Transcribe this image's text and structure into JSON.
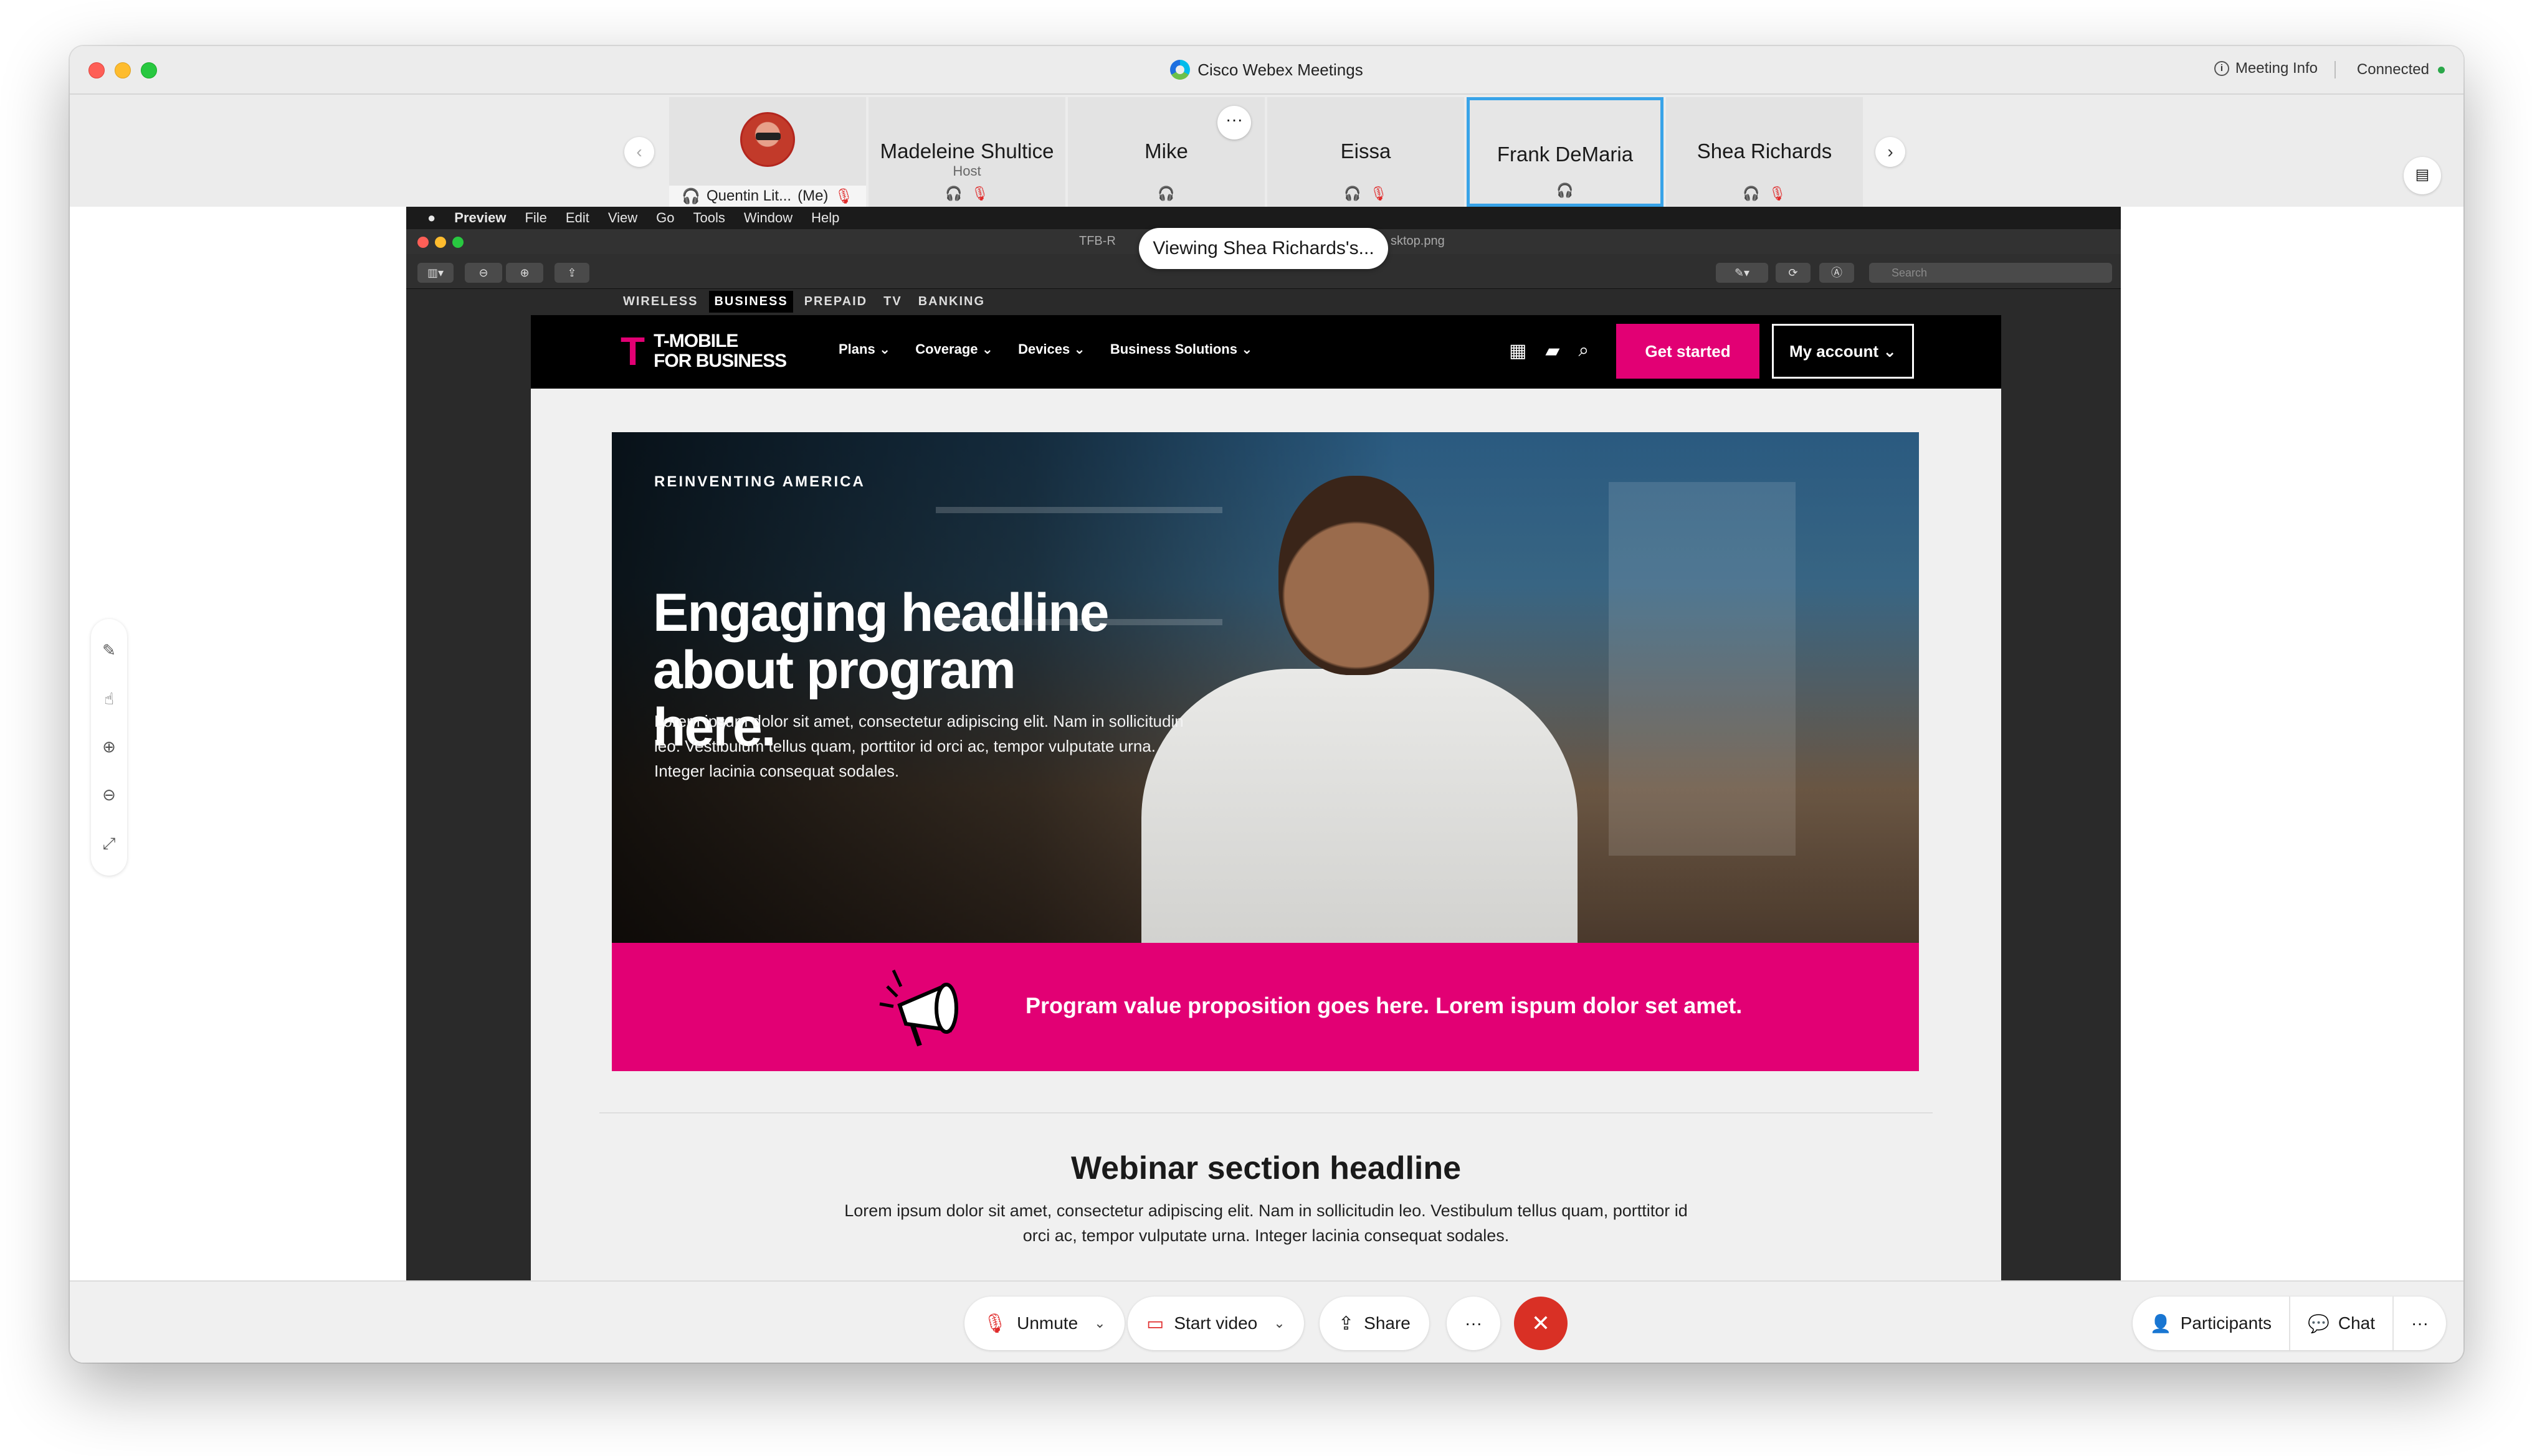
{
  "window": {
    "title": "Cisco Webex Meetings",
    "meeting_info_label": "Meeting Info",
    "connection_status": "Connected",
    "status_color": "#2ba84a"
  },
  "participants": [
    {
      "name": "Quentin Lit...",
      "suffix": "(Me)",
      "self": true,
      "muted": true
    },
    {
      "name": "Madeleine Shultice",
      "role": "Host",
      "muted": true
    },
    {
      "name": "Mike",
      "muted": false
    },
    {
      "name": "Eissa",
      "muted": true
    },
    {
      "name": "Frank DeMaria",
      "muted": false,
      "active_speaker": true
    },
    {
      "name": "Shea Richards",
      "muted": true,
      "sharing": true
    }
  ],
  "more_label": "···",
  "share_banner": "Viewing Shea Richards's...",
  "shared_app": {
    "menu": [
      "Preview",
      "File",
      "Edit",
      "View",
      "Go",
      "Tools",
      "Window",
      "Help"
    ],
    "file_name_left": "TFB-R",
    "file_name_right": "sktop.png",
    "search_placeholder": "Search"
  },
  "site": {
    "top_tabs": [
      "WIRELESS",
      "BUSINESS",
      "PREPAID",
      "TV",
      "BANKING"
    ],
    "active_top_tab": "BUSINESS",
    "logo_mark": "T",
    "logo_line1": "T-MOBILE",
    "logo_line2": "FOR BUSINESS",
    "nav": [
      "Plans",
      "Coverage",
      "Devices",
      "Business Solutions"
    ],
    "cta_primary": "Get started",
    "cta_account": "My account",
    "brand_color": "#e20074",
    "hero": {
      "eyebrow": "REINVENTING AMERICA",
      "headline": "Engaging headline about program here.",
      "body": "Lorem ipsum dolor sit amet, consectetur adipiscing elit. Nam in sollicitudin leo. Vestibulum tellus quam, porttitor id orci ac, tempor vulputate urna. Integer lacinia consequat sodales."
    },
    "value_prop": "Program value proposition goes here. Lorem ispum dolor set amet.",
    "webinar": {
      "headline": "Webinar section headline",
      "body": "Lorem ipsum dolor sit amet, consectetur adipiscing elit. Nam in sollicitudin leo. Vestibulum tellus quam, porttitor id orci ac, tempor vulputate urna. Integer lacinia consequat sodales."
    }
  },
  "controls": {
    "unmute": "Unmute",
    "start_video": "Start video",
    "share": "Share",
    "more": "···",
    "participants": "Participants",
    "chat": "Chat",
    "end_color": "#d93025"
  }
}
